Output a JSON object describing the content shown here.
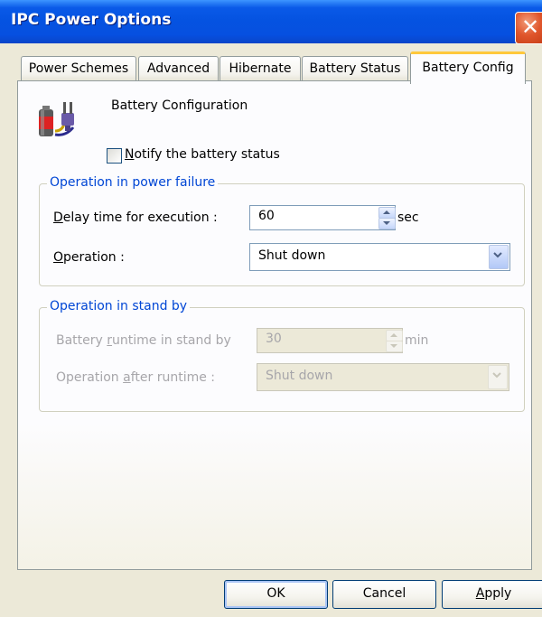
{
  "window": {
    "title": "IPC Power Options",
    "close_symbol": "✕"
  },
  "tabs": [
    {
      "label": "Power Schemes",
      "active": false
    },
    {
      "label": "Advanced",
      "active": false
    },
    {
      "label": "Hibernate",
      "active": false
    },
    {
      "label": "Battery Status",
      "active": false
    },
    {
      "label": "Battery Config",
      "active": true
    }
  ],
  "header": {
    "label": "Battery Configuration",
    "icon": "battery-plug-icon"
  },
  "notify": {
    "label_mnemonic": "N",
    "label_rest": "otify the battery status",
    "checked": false
  },
  "power_failure": {
    "legend": "Operation in power failure",
    "delay": {
      "label_mnemonic": "D",
      "label_rest": "elay time for execution :",
      "value": "60",
      "unit": "sec"
    },
    "operation": {
      "label_mnemonic": "O",
      "label_rest": "peration :",
      "value": "Shut down"
    }
  },
  "stand_by": {
    "legend": "Operation in stand by",
    "runtime": {
      "label_pre": "Battery ",
      "label_mnemonic": "r",
      "label_rest": "untime in stand by",
      "value": "30",
      "unit": "min",
      "enabled": false
    },
    "after": {
      "label_pre": "Operation ",
      "label_mnemonic": "a",
      "label_rest": "fter runtime :",
      "value": "Shut down",
      "enabled": false
    }
  },
  "buttons": {
    "ok": "OK",
    "cancel": "Cancel",
    "apply_mnemonic": "A",
    "apply_rest": "pply"
  },
  "colors": {
    "titlebar": "#0553e1",
    "legend": "#0046d5",
    "active_tab_accent": "#ffc83c",
    "dialog_bg": "#ece9d8"
  }
}
